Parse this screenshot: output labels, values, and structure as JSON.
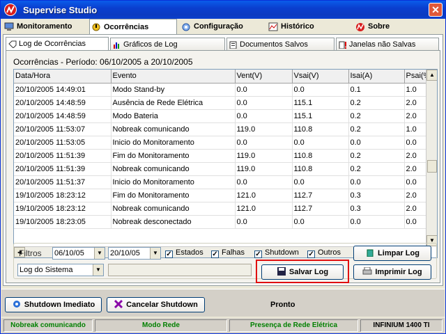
{
  "window": {
    "title": "Supervise Studio"
  },
  "main_tabs": [
    "Monitoramento",
    "Ocorrências",
    "Configuração",
    "Histórico",
    "Sobre"
  ],
  "sub_tabs": [
    "Log de Ocorrências",
    "Gráficos de Log",
    "Documentos Salvos",
    "Janelas não Salvas"
  ],
  "period": "Ocorrências - Período: 06/10/2005 a 20/10/2005",
  "table": {
    "columns": [
      "Data/Hora",
      "Evento",
      "Vent(V)",
      "Vsai(V)",
      "Isai(A)",
      "Psai(%"
    ],
    "rows": [
      [
        "20/10/2005 14:49:01",
        "Modo Stand-by",
        "0.0",
        "0.0",
        "0.1",
        "1.0"
      ],
      [
        "20/10/2005 14:48:59",
        "Ausência de Rede Elétrica",
        "0.0",
        "115.1",
        "0.2",
        "2.0"
      ],
      [
        "20/10/2005 14:48:59",
        "Modo Bateria",
        "0.0",
        "115.1",
        "0.2",
        "2.0"
      ],
      [
        "20/10/2005 11:53:07",
        "Nobreak comunicando",
        "119.0",
        "110.8",
        "0.2",
        "1.0"
      ],
      [
        "20/10/2005 11:53:05",
        "Inicio do Monitoramento",
        "0.0",
        "0.0",
        "0.0",
        "0.0"
      ],
      [
        "20/10/2005 11:51:39",
        "Fim do Monitoramento",
        "119.0",
        "110.8",
        "0.2",
        "2.0"
      ],
      [
        "20/10/2005 11:51:39",
        "Nobreak comunicando",
        "119.0",
        "110.8",
        "0.2",
        "2.0"
      ],
      [
        "20/10/2005 11:51:37",
        "Inicio do Monitoramento",
        "0.0",
        "0.0",
        "0.0",
        "0.0"
      ],
      [
        "19/10/2005 18:23:12",
        "Fim do Monitoramento",
        "121.0",
        "112.7",
        "0.3",
        "2.0"
      ],
      [
        "19/10/2005 18:23:12",
        "Nobreak comunicando",
        "121.0",
        "112.7",
        "0.3",
        "2.0"
      ],
      [
        "19/10/2005 18:23:05",
        "Nobreak desconectado",
        "0.0",
        "0.0",
        "0.0",
        "0.0"
      ]
    ]
  },
  "filters": {
    "label": "Filtros",
    "date_from": "06/10/05",
    "date_to": "20/10/05",
    "checks": [
      {
        "label": "Estados",
        "checked": true
      },
      {
        "label": "Falhas",
        "checked": true
      },
      {
        "label": "Shutdown",
        "checked": true
      },
      {
        "label": "Outros",
        "checked": true
      }
    ],
    "log_select": "Log do Sistema",
    "clear_btn": "Limpar Log",
    "save_btn": "Salvar Log",
    "print_btn": "Imprimir Log"
  },
  "bottom": {
    "shutdown_btn": "Shutdown Imediato",
    "cancel_btn": "Cancelar Shutdown",
    "state": "Pronto"
  },
  "status": [
    "Nobreak comunicando",
    "Modo Rede",
    "Presença de Rede Elétrica",
    "INFINIUM 1400 TI"
  ]
}
